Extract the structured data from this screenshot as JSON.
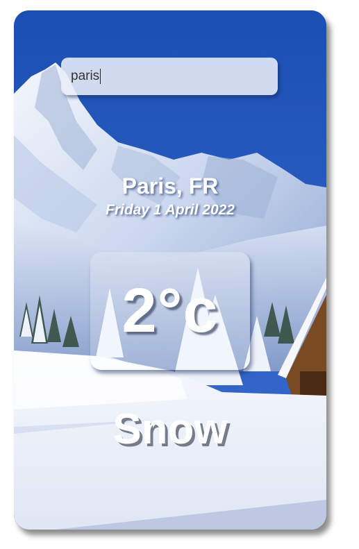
{
  "search": {
    "value": "paris",
    "placeholder": ""
  },
  "location": {
    "city_country": "Paris, FR",
    "date": "Friday 1 April 2022"
  },
  "current": {
    "temperature": "2°c",
    "condition": "Snow"
  },
  "theme": {
    "sky": "#1f55b8",
    "snow": "#eef2fb",
    "text": "#ffffff"
  }
}
